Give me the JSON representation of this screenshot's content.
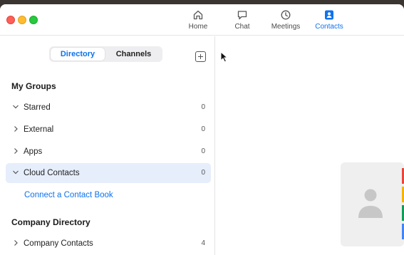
{
  "nav": {
    "home": "Home",
    "chat": "Chat",
    "meetings": "Meetings",
    "contacts": "Contacts",
    "active": "contacts"
  },
  "tabs": {
    "directory": "Directory",
    "channels": "Channels",
    "selected": "Directory"
  },
  "my_groups": {
    "title": "My Groups",
    "items": [
      {
        "label": "Starred",
        "count": "0",
        "expanded": true
      },
      {
        "label": "External",
        "count": "0",
        "expanded": false
      },
      {
        "label": "Apps",
        "count": "0",
        "expanded": false
      },
      {
        "label": "Cloud Contacts",
        "count": "0",
        "expanded": true,
        "selected": true
      }
    ],
    "connect_link": "Connect a Contact Book"
  },
  "company": {
    "title": "Company Directory",
    "items": [
      {
        "label": "Company Contacts",
        "count": "4",
        "expanded": false
      }
    ]
  },
  "colors": {
    "accent": "#0e72ed",
    "selected_row": "#e6eefc"
  },
  "icons": [
    "home-icon",
    "chat-icon",
    "clock-icon",
    "contacts-icon",
    "add-icon",
    "chevron-down-icon",
    "chevron-right-icon",
    "avatar-icon"
  ]
}
